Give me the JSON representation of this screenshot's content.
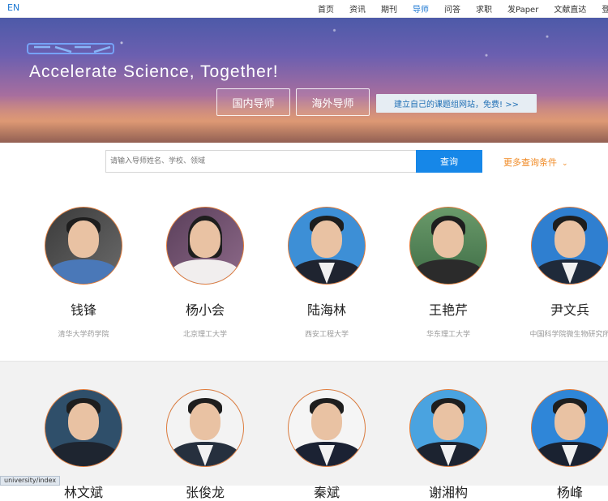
{
  "topbar": {
    "lang": "EN",
    "nav": [
      "首页",
      "资讯",
      "期刊",
      "导师",
      "问答",
      "求职",
      "发Paper",
      "文献直达",
      "登"
    ]
  },
  "banner": {
    "slogan": "Accelerate Science, Together!",
    "btn_domestic": "国内导师",
    "btn_abroad": "海外导师",
    "btn_build": "建立自己的课题组网站，免费! >>"
  },
  "search": {
    "placeholder": "请输入导师姓名、学校、领域",
    "button": "查询",
    "more": "更多查询条件",
    "more_icon": "chevron-down-icon"
  },
  "row1": [
    {
      "name": "钱锋",
      "school": "清华大学药学院"
    },
    {
      "name": "杨小会",
      "school": "北京理工大学"
    },
    {
      "name": "陆海林",
      "school": "西安工程大学"
    },
    {
      "name": "王艳芹",
      "school": "华东理工大学"
    },
    {
      "name": "尹文兵",
      "school": "中国科学院微生物研究所"
    }
  ],
  "row2": [
    {
      "name": "林文斌"
    },
    {
      "name": "张俊龙"
    },
    {
      "name": "秦斌"
    },
    {
      "name": "谢湘构"
    },
    {
      "name": "杨峰"
    }
  ],
  "status": "university/index",
  "colors": {
    "accent": "#1687e8",
    "orange": "#f08a24",
    "avatar_border": "#e07a38"
  }
}
